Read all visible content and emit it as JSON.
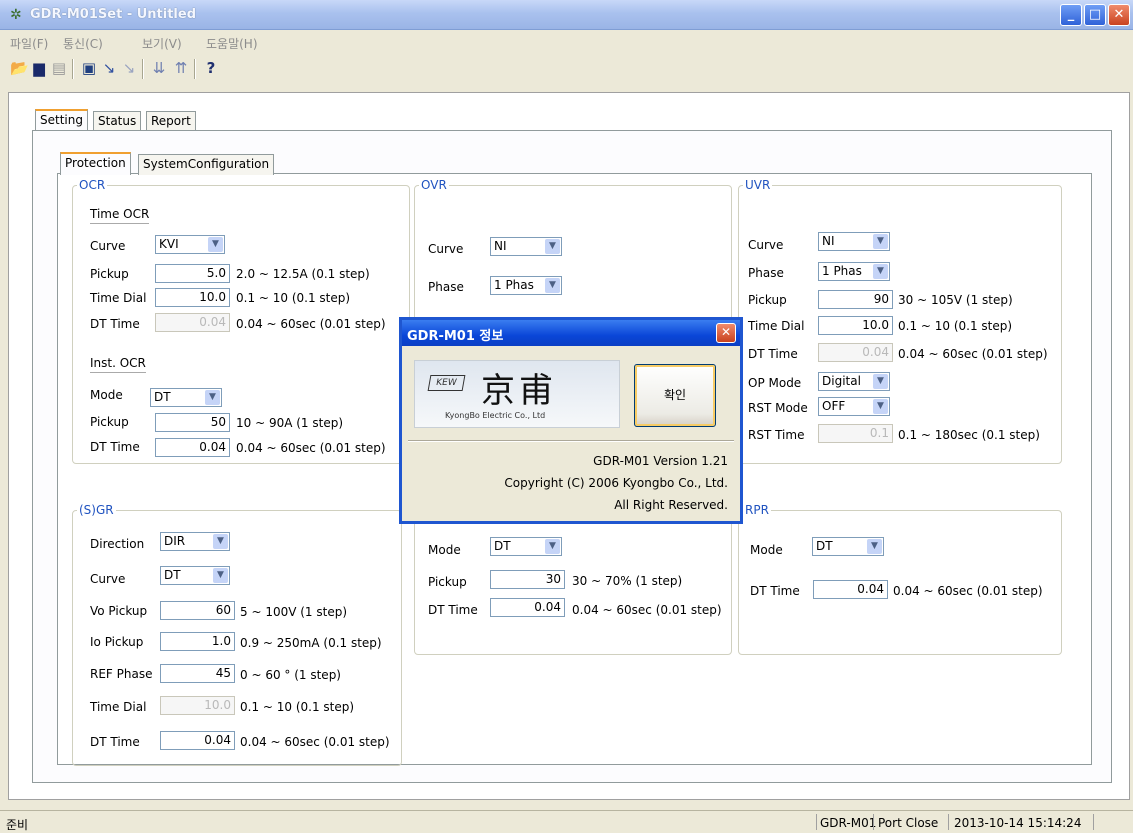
{
  "window": {
    "title": "GDR-M01Set - Untitled"
  },
  "menu": [
    "파일(F)",
    "통신(C)",
    "보기(V)",
    "도움말(H)"
  ],
  "tabs_outer": [
    "Setting",
    "Status",
    "Report"
  ],
  "tabs_inner": [
    "Protection",
    "SystemConfiguration"
  ],
  "ocr": {
    "legend": "OCR",
    "time_title": "Time OCR",
    "curve_label": "Curve",
    "curve": "KVI",
    "pickup_label": "Pickup",
    "pickup": "5.0",
    "pickup_range": "2.0 ~ 12.5A (0.1 step)",
    "timedial_label": "Time Dial",
    "timedial": "10.0",
    "timedial_range": "0.1 ~ 10 (0.1 step)",
    "dttime_label": "DT Time",
    "dttime": "0.04",
    "dttime_range": "0.04 ~ 60sec (0.01 step)",
    "inst_title": "Inst. OCR",
    "mode_label": "Mode",
    "mode": "DT",
    "ipickup_label": "Pickup",
    "ipickup": "50",
    "ipickup_range": "10 ~ 90A (1 step)",
    "idttime_label": "DT Time",
    "idttime": "0.04",
    "idttime_range": "0.04 ~ 60sec (0.01 step)"
  },
  "ovr": {
    "legend": "OVR",
    "curve_label": "Curve",
    "curve": "NI",
    "phase_label": "Phase",
    "phase": "1 Phas"
  },
  "uvr": {
    "legend": "UVR",
    "curve_label": "Curve",
    "curve": "NI",
    "phase_label": "Phase",
    "phase": "1 Phas",
    "pickup_label": "Pickup",
    "pickup": "90",
    "pickup_range": "30 ~ 105V (1 step)",
    "timedial_label": "Time Dial",
    "timedial": "10.0",
    "timedial_range": "0.1 ~ 10 (0.1 step)",
    "dttime_label": "DT Time",
    "dttime": "0.04",
    "dttime_range": "0.04 ~ 60sec (0.01 step)",
    "opmode_label": "OP Mode",
    "opmode": "Digital",
    "rstmode_label": "RST Mode",
    "rstmode": "OFF",
    "rsttime_label": "RST Time",
    "rsttime": "0.1",
    "rsttime_range": "0.1 ~ 180sec (0.1 step)"
  },
  "sgr": {
    "legend": "(S)GR",
    "direction_label": "Direction",
    "direction": "DIR",
    "curve_label": "Curve",
    "curve": "DT",
    "vo_label": "Vo Pickup",
    "vo": "60",
    "vo_range": "5 ~ 100V (1 step)",
    "io_label": "Io Pickup",
    "io": "1.0",
    "io_range": "0.9 ~ 250mA (0.1 step)",
    "ref_label": "REF Phase",
    "ref": "45",
    "ref_range": "0 ~ 60 ° (1 step)",
    "timedial_label": "Time Dial",
    "timedial": "10.0",
    "timedial_range": "0.1 ~ 10 (0.1 step)",
    "dttime_label": "DT Time",
    "dttime": "0.04",
    "dttime_range": "0.04 ~ 60sec (0.01 step)"
  },
  "mid": {
    "mode_label": "Mode",
    "mode": "DT",
    "pickup_label": "Pickup",
    "pickup": "30",
    "pickup_range": "30 ~ 70% (1 step)",
    "dttime_label": "DT Time",
    "dttime": "0.04",
    "dttime_range": "0.04 ~ 60sec (0.01 step)"
  },
  "rpr": {
    "legend": "RPR",
    "mode_label": "Mode",
    "mode": "DT",
    "dttime_label": "DT Time",
    "dttime": "0.04",
    "dttime_range": "0.04 ~ 60sec (0.01 step)"
  },
  "dialog": {
    "title": "GDR-M01 정보",
    "ok": "확인",
    "logo_mark": "KEW",
    "logo_chars": "京甫",
    "logo_company": "KyongBo Electric Co., Ltd",
    "version": "GDR-M01 Version 1.21",
    "copyright": "Copyright (C) 2006 Kyongbo Co., Ltd.",
    "rights": "All Right Reserved."
  },
  "status": {
    "left": "준비",
    "device": "GDR-M01",
    "port": "Port Close",
    "datetime": "2013-10-14 15:14:24"
  }
}
